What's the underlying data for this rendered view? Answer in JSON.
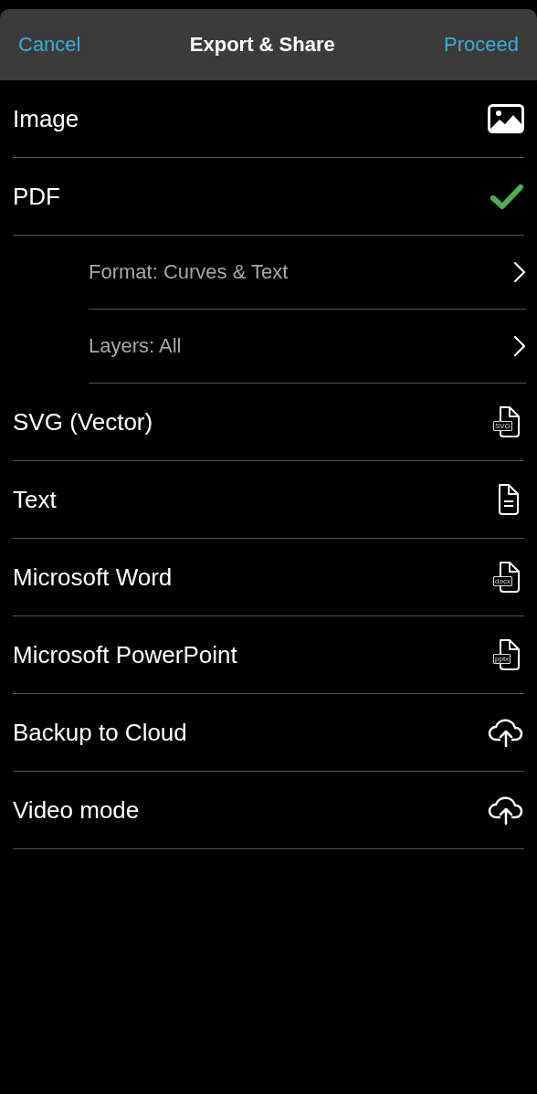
{
  "header": {
    "cancel": "Cancel",
    "title": "Export & Share",
    "proceed": "Proceed"
  },
  "options": [
    {
      "kind": "image",
      "label": "Image",
      "selected": false
    },
    {
      "kind": "document",
      "label": "PDF",
      "selected": true
    },
    {
      "kind": "setting",
      "label": "Format: Curves & Text"
    },
    {
      "kind": "setting",
      "label": "Layers: All"
    },
    {
      "kind": "document",
      "label": "SVG (Vector)",
      "badge": "SVG",
      "selected": false
    },
    {
      "kind": "text",
      "label": "Text",
      "selected": false
    },
    {
      "kind": "document",
      "label": "Microsoft Word",
      "badge": "docx",
      "selected": false
    },
    {
      "kind": "document",
      "label": "Microsoft PowerPoint",
      "badge": "pptx",
      "selected": false
    },
    {
      "kind": "cloud",
      "label": "Backup to Cloud",
      "selected": false
    },
    {
      "kind": "cloud",
      "label": "Video mode",
      "selected": false
    }
  ]
}
